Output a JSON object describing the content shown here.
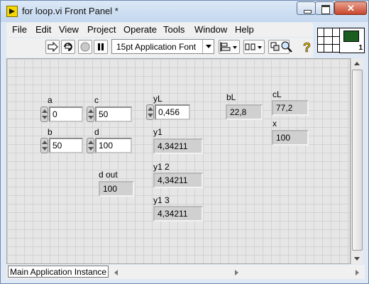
{
  "window": {
    "title": "for loop.vi Front Panel *"
  },
  "menu": [
    "File",
    "Edit",
    "View",
    "Project",
    "Operate",
    "Tools",
    "Window",
    "Help"
  ],
  "toolbar": {
    "font": "15pt Application Font",
    "icons": [
      "run-arrow-icon",
      "run-continuously-icon",
      "abort-icon",
      "pause-icon",
      "align-icon",
      "distribute-icon",
      "reorder-icon",
      "search-icon",
      "help-icon"
    ]
  },
  "vi_icon": {
    "number": "1"
  },
  "controls": {
    "a": {
      "label": "a",
      "value": "0"
    },
    "b": {
      "label": "b",
      "value": "50"
    },
    "c": {
      "label": "c",
      "value": "50"
    },
    "d": {
      "label": "d",
      "value": "100"
    },
    "yL": {
      "label": "yL",
      "value": "0,456"
    }
  },
  "indicators": {
    "d_out": {
      "label": "d out",
      "value": "100"
    },
    "y1": {
      "label": "y1",
      "value": "4,34211"
    },
    "y1_2": {
      "label": "y1 2",
      "value": "4,34211"
    },
    "y1_3": {
      "label": "y1 3",
      "value": "4,34211"
    },
    "bL": {
      "label": "bL",
      "value": "22,8"
    },
    "cL": {
      "label": "cL",
      "value": "77,2"
    },
    "x": {
      "label": "x",
      "value": "100"
    }
  },
  "status": {
    "instance": "Main Application Instance"
  }
}
